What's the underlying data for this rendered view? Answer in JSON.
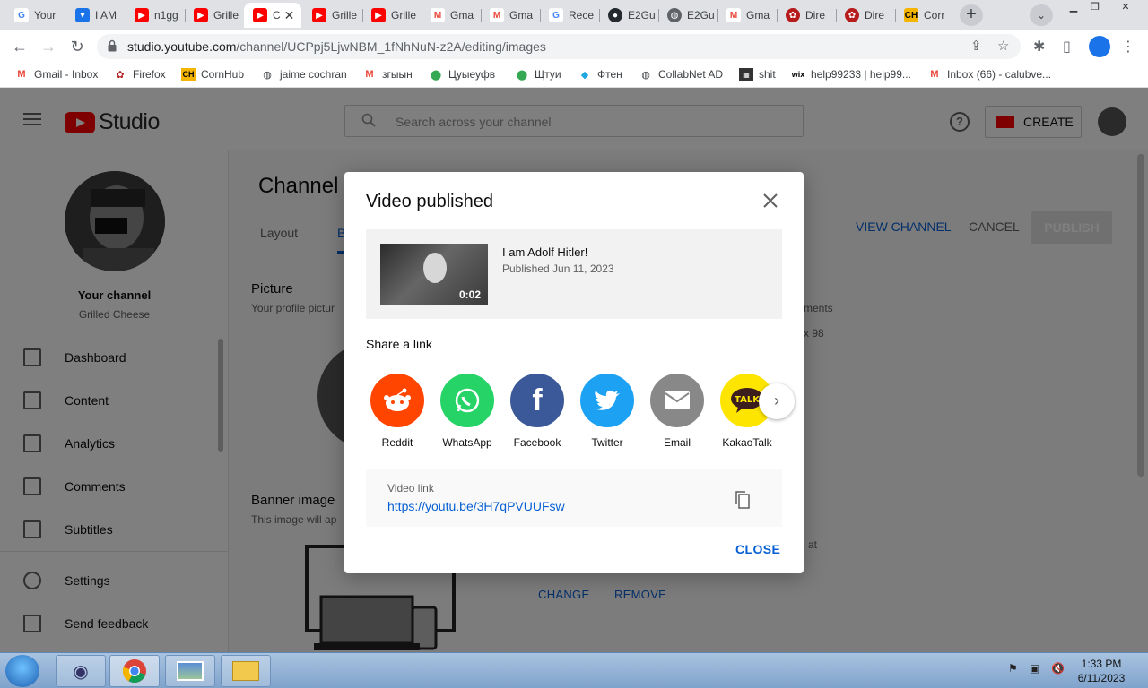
{
  "browser": {
    "tabs": [
      {
        "title": "Your",
        "icon": "google-icon",
        "color": "#4285f4"
      },
      {
        "title": "I AM",
        "icon": "shield-icon",
        "color": "#1a73e8"
      },
      {
        "title": "n1gg",
        "icon": "youtube-icon",
        "color": "#ff0000"
      },
      {
        "title": "Grille",
        "icon": "youtube-icon",
        "color": "#ff0000"
      },
      {
        "title": "C",
        "icon": "youtube-icon",
        "color": "#ff0000",
        "active": true
      },
      {
        "title": "Grille",
        "icon": "youtube-icon",
        "color": "#ff0000"
      },
      {
        "title": "Grille",
        "icon": "youtube-icon",
        "color": "#ff0000"
      },
      {
        "title": "Gma",
        "icon": "gmail-icon",
        "color": "#ea4335"
      },
      {
        "title": "Gma",
        "icon": "gmail-icon",
        "color": "#ea4335"
      },
      {
        "title": "Rece",
        "icon": "google-icon",
        "color": "#4285f4"
      },
      {
        "title": "E2Gu",
        "icon": "github-icon",
        "color": "#24292e"
      },
      {
        "title": "E2Gu",
        "icon": "globe-icon",
        "color": "#5f6368"
      },
      {
        "title": "Gma",
        "icon": "gmail-icon",
        "color": "#ea4335"
      },
      {
        "title": "Dire",
        "icon": "leaf-icon",
        "color": "#b71c1c"
      },
      {
        "title": "Dire",
        "icon": "leaf-icon",
        "color": "#b71c1c"
      },
      {
        "title": "Corr",
        "icon": "ch-icon",
        "color": "#f4b400"
      }
    ],
    "url_host": "studio.youtube.com",
    "url_path": "/channel/UCPpj5LjwNBM_1fNhNuN-z2A/editing/images",
    "bookmarks": [
      {
        "label": "Gmail - Inbox",
        "icon": "gmail-icon"
      },
      {
        "label": "Firefox",
        "icon": "leaf-icon"
      },
      {
        "label": "CornHub",
        "icon": "ch-icon"
      },
      {
        "label": "jaime cochran",
        "icon": "globe-icon"
      },
      {
        "label": "згыын",
        "icon": "gmail-icon"
      },
      {
        "label": "Цуыеуфв",
        "icon": "map-pin-icon"
      },
      {
        "label": "Щтуи",
        "icon": "map-pin-icon"
      },
      {
        "label": "Фтен",
        "icon": "diamond-icon"
      },
      {
        "label": "CollabNet AD",
        "icon": "globe-icon"
      },
      {
        "label": "shit",
        "icon": "app-icon"
      },
      {
        "label": "help99233 | help99...",
        "icon": "wix-icon"
      },
      {
        "label": "Inbox (66) - calubve...",
        "icon": "gmail-icon"
      }
    ]
  },
  "studio": {
    "logo_text": "Studio",
    "search_placeholder": "Search across your channel",
    "create_label": "CREATE",
    "help_glyph": "?",
    "sidebar": {
      "channel_title": "Your channel",
      "channel_name": "Grilled Cheese",
      "items": [
        {
          "label": "Dashboard",
          "icon": "dashboard-icon"
        },
        {
          "label": "Content",
          "icon": "content-icon"
        },
        {
          "label": "Analytics",
          "icon": "analytics-icon"
        },
        {
          "label": "Comments",
          "icon": "comments-icon"
        },
        {
          "label": "Subtitles",
          "icon": "subtitles-icon"
        },
        {
          "label": "Settings",
          "icon": "gear-icon"
        },
        {
          "label": "Send feedback",
          "icon": "feedback-icon"
        }
      ]
    },
    "main": {
      "title": "Channel c",
      "tabs": [
        "Layout",
        "B"
      ],
      "view_channel": "VIEW CHANNEL",
      "cancel": "CANCEL",
      "publish": "PUBLISH",
      "picture_title": "Picture",
      "picture_desc": "Your profile pictur",
      "right_frag_1": "mments",
      "right_frag_2": "x 98",
      "right_frag_3": "t's at",
      "banner_title": "Banner image",
      "banner_desc": "This image will ap",
      "change": "CHANGE",
      "remove": "REMOVE"
    }
  },
  "dialog": {
    "title": "Video published",
    "video_title": "I am Adolf Hitler!",
    "video_date": "Published Jun 11, 2023",
    "video_duration": "0:02",
    "share_title": "Share a link",
    "share_items": [
      {
        "label": "Reddit",
        "icon": "reddit-icon",
        "color": "#ff4500"
      },
      {
        "label": "WhatsApp",
        "icon": "whatsapp-icon",
        "color": "#25d366"
      },
      {
        "label": "Facebook",
        "icon": "facebook-icon",
        "color": "#3b5998"
      },
      {
        "label": "Twitter",
        "icon": "twitter-icon",
        "color": "#1da1f2"
      },
      {
        "label": "Email",
        "icon": "email-icon",
        "color": "#888888"
      },
      {
        "label": "KakaoTalk",
        "icon": "kakaotalk-icon",
        "color": "#fee500"
      }
    ],
    "link_label": "Video link",
    "link_url": "https://youtu.be/3H7qPVUUFsw",
    "close_label": "CLOSE"
  },
  "taskbar": {
    "time": "1:33 PM",
    "date": "6/11/2023"
  }
}
